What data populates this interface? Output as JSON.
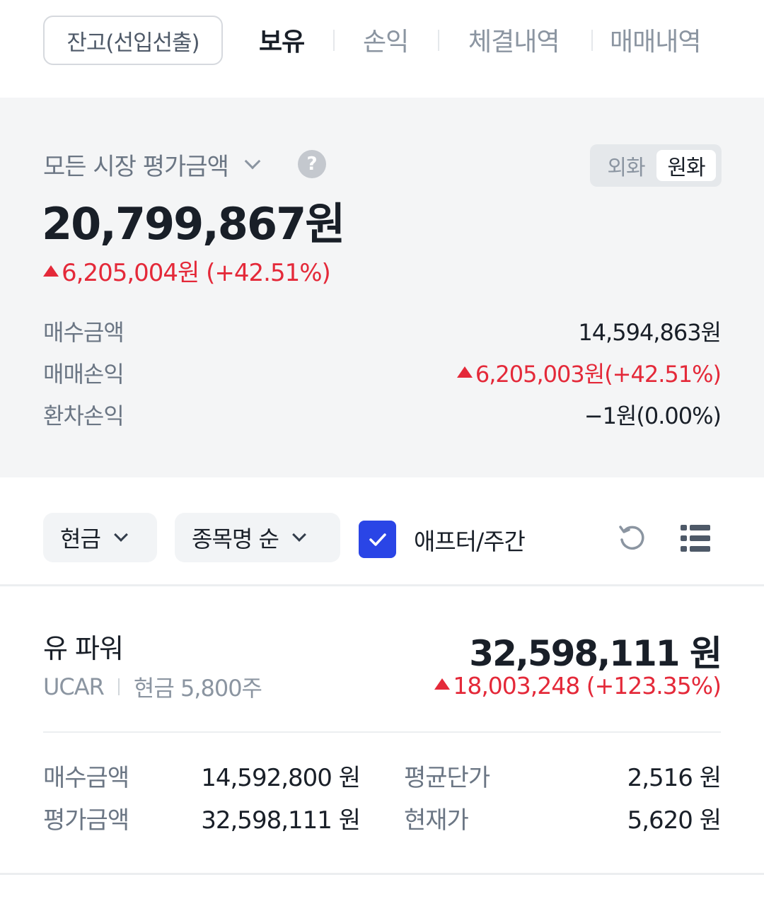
{
  "tabs": {
    "balance_button": "잔고(선입선출)",
    "items": [
      "보유",
      "손익",
      "체결내역",
      "매매내역"
    ],
    "active": "보유"
  },
  "summary": {
    "title": "모든 시장 평가금액",
    "help_icon": "question-icon",
    "currency_toggle": {
      "foreign": "외화",
      "krw": "원화",
      "selected": "원화"
    },
    "total_eval": "20,799,867원",
    "total_change": "6,205,004원 (+42.51%)",
    "rows": [
      {
        "label": "매수금액",
        "value": "14,594,863원"
      },
      {
        "label": "매매손익",
        "value": "6,205,003원(+42.51%)"
      },
      {
        "label": "환차손익",
        "value": "−1원(0.00%)"
      }
    ]
  },
  "filters": {
    "type": "현금",
    "sort": "종목명 순",
    "afterhours_label": "애프터/주간",
    "afterhours_checked": true
  },
  "holding": {
    "name": "유 파워",
    "ticker": "UCAR",
    "account": "현금 5,800주",
    "eval_amount": "32,598,111 원",
    "change": "18,003,248 (+123.35%)",
    "details": {
      "buy_label": "매수금액",
      "buy_value": "14,592,800 원",
      "eval_label": "평가금액",
      "eval_value": "32,598,111 원",
      "avg_label": "평균단가",
      "avg_value": "2,516 원",
      "price_label": "현재가",
      "price_value": "5,620 원"
    }
  },
  "colors": {
    "up": "#e42939",
    "accent": "#2a45e6"
  }
}
